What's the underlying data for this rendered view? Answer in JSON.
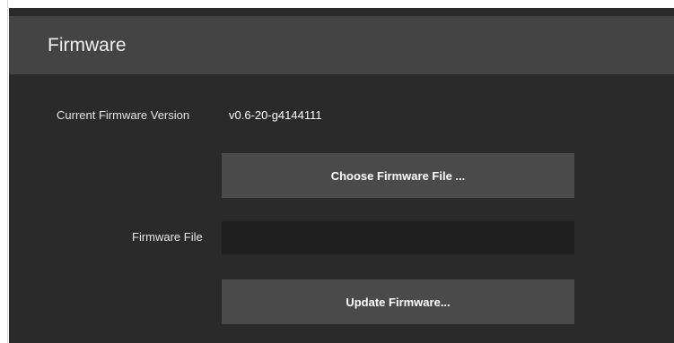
{
  "panel": {
    "title": "Firmware"
  },
  "current_version": {
    "label": "Current Firmware Version",
    "value": "v0.6-20-g4144111"
  },
  "choose_button": {
    "label": "Choose Firmware File ..."
  },
  "firmware_file": {
    "label": "Firmware File",
    "value": ""
  },
  "update_button": {
    "label": "Update Firmware..."
  },
  "colors": {
    "panel_background": "#2a2a2a",
    "header_background": "#444444",
    "button_background": "#4a4a4a",
    "field_background": "#1f1f1f",
    "text": "#ffffff"
  }
}
